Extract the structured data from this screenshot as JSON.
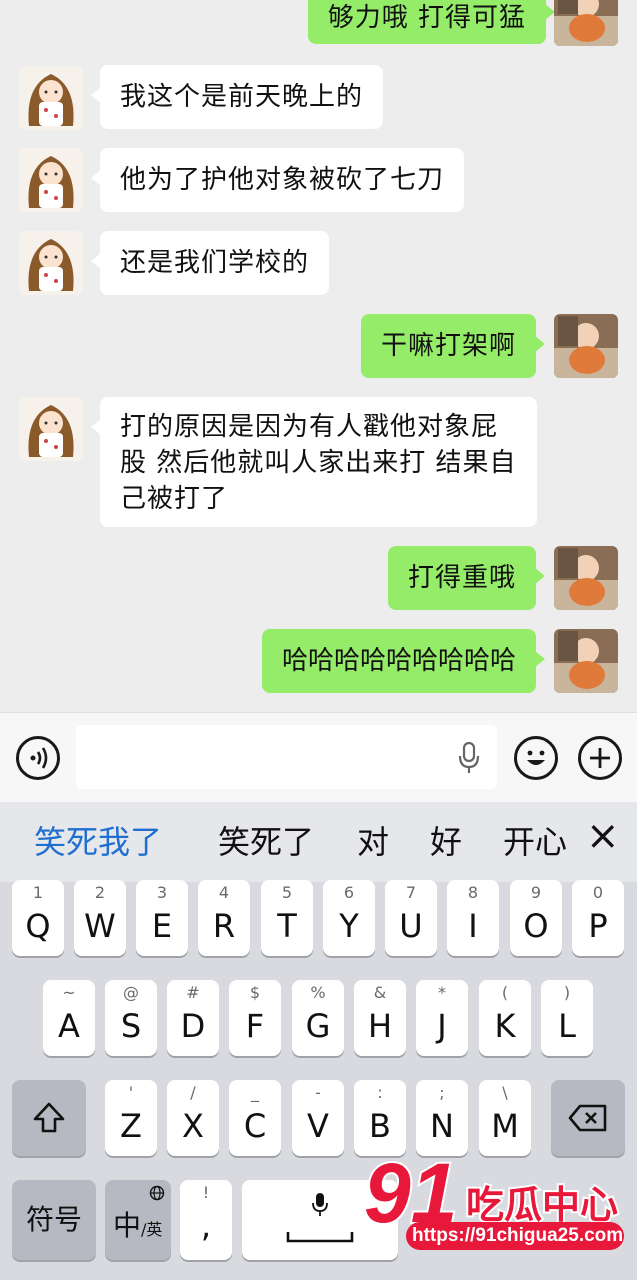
{
  "messages": [
    {
      "side": "out",
      "text": "够力哦 打得可猛"
    },
    {
      "side": "in",
      "text": "我这个是前天晚上的"
    },
    {
      "side": "in",
      "text": "他为了护他对象被砍了七刀"
    },
    {
      "side": "in",
      "text": "还是我们学校的"
    },
    {
      "side": "out",
      "text": "干嘛打架啊"
    },
    {
      "side": "in",
      "lines": [
        "打的原因是因为有人戳他对象屁",
        "股 然后他就叫人家出来打 结果自",
        "己被打了"
      ]
    },
    {
      "side": "out",
      "text": "打得重哦"
    },
    {
      "side": "out",
      "text": "哈哈哈哈哈哈哈哈哈"
    }
  ],
  "input_bar": {
    "voice_icon": "voice-wave-icon",
    "mic_icon": "microphone-icon",
    "emoji_icon": "smiley-icon",
    "plus_icon": "plus-circle-icon"
  },
  "candidates": [
    "笑死我了",
    "笑死了",
    "对",
    "好",
    "开心"
  ],
  "candidate_close": "×",
  "keyboard": {
    "row1": [
      {
        "sub": "1",
        "main": "Q"
      },
      {
        "sub": "2",
        "main": "W"
      },
      {
        "sub": "3",
        "main": "E"
      },
      {
        "sub": "4",
        "main": "R"
      },
      {
        "sub": "5",
        "main": "T"
      },
      {
        "sub": "6",
        "main": "Y"
      },
      {
        "sub": "7",
        "main": "U"
      },
      {
        "sub": "8",
        "main": "I"
      },
      {
        "sub": "9",
        "main": "O"
      },
      {
        "sub": "0",
        "main": "P"
      }
    ],
    "row2": [
      {
        "sub": "~",
        "main": "A"
      },
      {
        "sub": "@",
        "main": "S"
      },
      {
        "sub": "#",
        "main": "D"
      },
      {
        "sub": "$",
        "main": "F"
      },
      {
        "sub": "%",
        "main": "G"
      },
      {
        "sub": "&",
        "main": "H"
      },
      {
        "sub": "*",
        "main": "J"
      },
      {
        "sub": "(",
        "main": "K"
      },
      {
        "sub": ")",
        "main": "L"
      }
    ],
    "row3": [
      {
        "sub": "'",
        "main": "Z"
      },
      {
        "sub": "/",
        "main": "X"
      },
      {
        "sub": "_",
        "main": "C"
      },
      {
        "sub": "-",
        "main": "V"
      },
      {
        "sub": ":",
        "main": "B"
      },
      {
        "sub": ";",
        "main": "N"
      },
      {
        "sub": "\\",
        "main": "M"
      }
    ],
    "shift_icon": "shift-arrow-icon",
    "backspace_icon": "backspace-icon",
    "symbols_label": "符号",
    "lang_main": "中",
    "lang_sub": "/英",
    "comma_sub": "!",
    "comma_main": ",",
    "space_mic_icon": "microphone-icon"
  },
  "watermark": {
    "logo_number": "91",
    "logo_text": "吃瓜中心",
    "url": "https://91chigua25.com"
  },
  "colors": {
    "incoming_bubble": "#ffffff",
    "outgoing_bubble": "#95ec69",
    "candidate_highlight": "#1e6fd0",
    "watermark_red": "#e8183a"
  }
}
